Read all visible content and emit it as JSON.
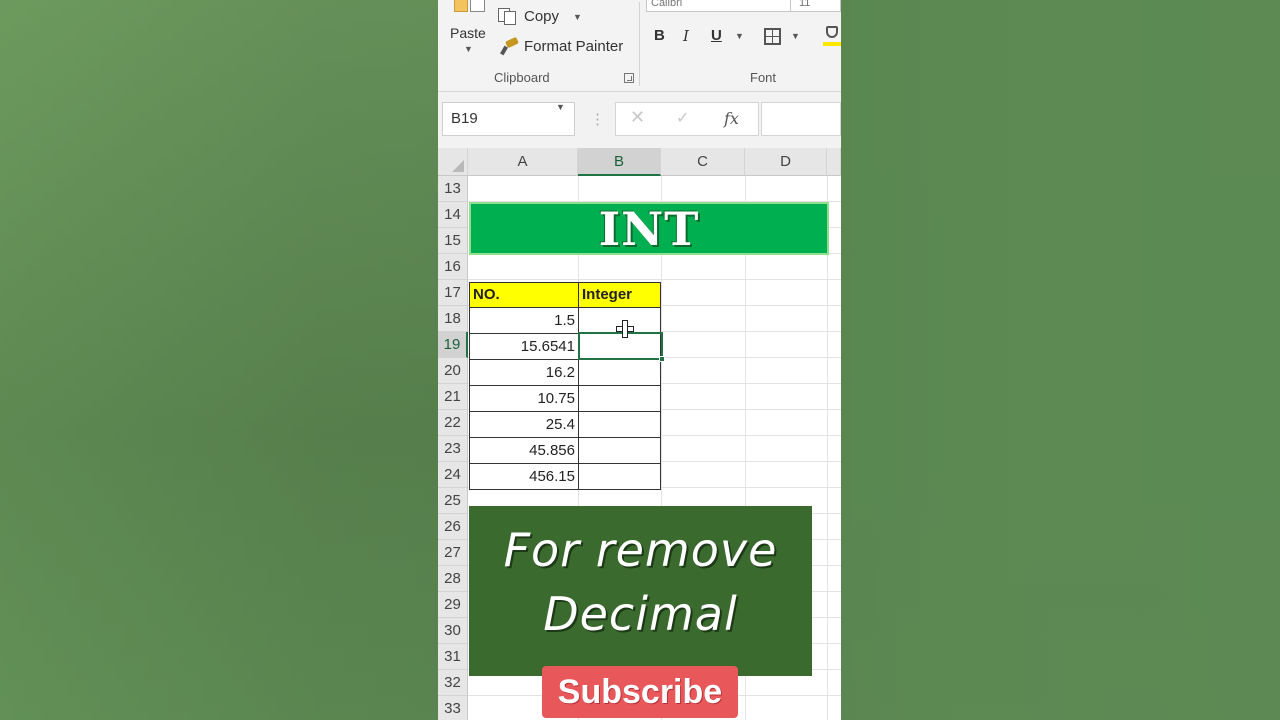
{
  "ribbon": {
    "clipboard": {
      "paste_label": "Paste",
      "copy_label": "Copy",
      "format_painter_label": "Format Painter",
      "group_label": "Clipboard"
    },
    "font": {
      "font_name": "Calibri",
      "font_size": "11",
      "bold_label": "B",
      "italic_label": "I",
      "underline_label": "U",
      "group_label": "Font",
      "fill_color": "#ffe600"
    }
  },
  "formula_bar": {
    "name_box": "B19",
    "cancel_symbol": "✕",
    "enter_symbol": "✓",
    "fx_label": "fx",
    "content": ""
  },
  "sheet": {
    "columns": [
      "A",
      "B",
      "C",
      "D"
    ],
    "selected_column": "B",
    "rows": [
      "13",
      "14",
      "15",
      "16",
      "17",
      "18",
      "19",
      "20",
      "21",
      "22",
      "23",
      "24",
      "25",
      "26",
      "27",
      "28",
      "29",
      "30",
      "31",
      "32",
      "33"
    ],
    "selected_row": "19",
    "title": "INT",
    "title_color": "#00b050",
    "table": {
      "headers": [
        "NO.",
        "Integer"
      ],
      "header_color": "#ffff00",
      "values": [
        "1.5",
        "15.6541",
        "16.2",
        "10.75",
        "25.4",
        "45.856",
        "456.15"
      ]
    },
    "active_cell": "B19"
  },
  "overlay": {
    "promo_line1": "For remove",
    "promo_line2": "Decimal",
    "promo_color": "#3a6a2e",
    "subscribe_label": "Subscribe",
    "subscribe_color": "#e8585b"
  }
}
